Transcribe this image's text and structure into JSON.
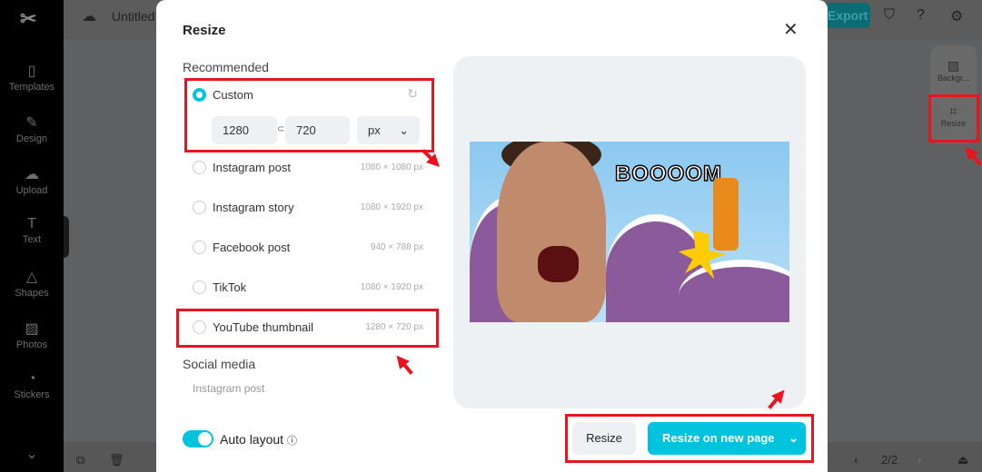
{
  "sidebar": {
    "items": [
      {
        "label": "Templates",
        "icon": "templates-icon"
      },
      {
        "label": "Design",
        "icon": "design-icon"
      },
      {
        "label": "Upload",
        "icon": "upload-icon"
      },
      {
        "label": "Text",
        "icon": "text-icon"
      },
      {
        "label": "Shapes",
        "icon": "shapes-icon"
      },
      {
        "label": "Photos",
        "icon": "photos-icon"
      },
      {
        "label": "Stickers",
        "icon": "stickers-icon"
      }
    ]
  },
  "topbar": {
    "title": "Untitled",
    "export_label": "Export"
  },
  "right_panel": {
    "items": [
      {
        "label": "Backgr..."
      },
      {
        "label": "Resize"
      }
    ]
  },
  "pager": {
    "text": "2/2"
  },
  "modal": {
    "title": "Resize",
    "recommended_label": "Recommended",
    "custom": {
      "label": "Custom",
      "width": "1280",
      "height": "720",
      "unit": "px",
      "selected": true
    },
    "options": [
      {
        "label": "Instagram post",
        "size": "1080 × 1080 px"
      },
      {
        "label": "Instagram story",
        "size": "1080 × 1920 px"
      },
      {
        "label": "Facebook post",
        "size": "940 × 788 px"
      },
      {
        "label": "TikTok",
        "size": "1080 × 1920 px"
      },
      {
        "label": "YouTube thumbnail",
        "size": "1280 × 720 px"
      }
    ],
    "social_media_label": "Social media",
    "social_items": [
      "Instagram post"
    ],
    "preview_text": "BOOOOM",
    "auto_layout_label": "Auto layout",
    "auto_layout_on": true,
    "resize_label": "Resize",
    "resize_new_page_label": "Resize on new page"
  },
  "colors": {
    "accent": "#00c4dd",
    "highlight": "#e8141f"
  }
}
